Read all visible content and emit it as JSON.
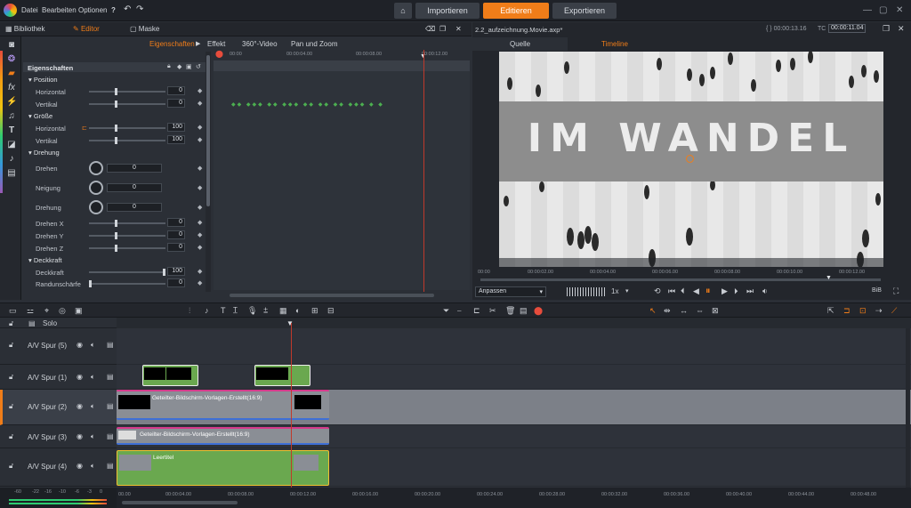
{
  "menu": {
    "items": [
      "Datei",
      "Bearbeiten",
      "Optionen"
    ]
  },
  "nav": {
    "home_icon": "home-icon",
    "import": "Importieren",
    "edit": "Editieren",
    "export": "Exportieren"
  },
  "left_tabs": {
    "library": "Bibliothek",
    "editor": "Editor",
    "mask": "Maske"
  },
  "sub_tabs": {
    "properties": "Eigenschaften",
    "effect": "Effekt",
    "video360": "360°-Video",
    "panzoom": "Pan und Zoom"
  },
  "props": {
    "header": "Eigenschaften",
    "position": "Position",
    "horizontal": "Horizontal",
    "vertical": "Vertikal",
    "size": "Größe",
    "rotation": "Drehung",
    "rotate": "Drehen",
    "tilt": "Neigung",
    "rotation_lbl": "Drehung",
    "rotate_x": "Drehen X",
    "rotate_y": "Drehen Y",
    "rotate_z": "Drehen Z",
    "opacity_group": "Deckkraft",
    "opacity": "Deckkraft",
    "edge_sharpness": "Randunschärfe",
    "values": {
      "pos_h": "0",
      "pos_v": "0",
      "size_h": "100",
      "size_v": "100",
      "rot": "0",
      "tilt": "0",
      "rotation": "0",
      "rot_x": "0",
      "rot_y": "0",
      "rot_z": "0",
      "opacity": "100",
      "edge": "0"
    }
  },
  "kf_ruler": {
    "t0": "00:00",
    "t1": "00:00:04.00",
    "t2": "00:00:08.00",
    "t3": "00:00:12.00"
  },
  "preview": {
    "file": "2.2_aufzeichnung.Movie.axp*",
    "tc_duration": "00:00:13.16",
    "tc_label": "TC",
    "tc_current": "00:00:11.04",
    "tab_source": "Quelle",
    "tab_timeline": "Timeline",
    "title_text": "IM WANDEL",
    "ruler": [
      "00:00",
      "00:00:02.00",
      "00:00:04.00",
      "00:00:06.00",
      "00:00:08.00",
      "00:00:10.00",
      "00:00:12.00"
    ],
    "fit": "Anpassen",
    "speed": "1x",
    "bib": "BiB"
  },
  "timeline": {
    "solo": "Solo",
    "tracks": [
      {
        "name": "A/V Spur (5)"
      },
      {
        "name": "A/V Spur (1)"
      },
      {
        "name": "A/V Spur (2)"
      },
      {
        "name": "A/V Spur (3)"
      },
      {
        "name": "A/V Spur (4)"
      }
    ],
    "clip_track2": "Geteilter-Bildschirm-Vorlagen-Erstellt(16:9)",
    "clip_track3": "Geteilter-Bildschirm-Vorlagen-Erstellt(16:9)",
    "clip_track4": "Leertitel",
    "ruler": [
      "00.00",
      "00:00:04.00",
      "00:00:08.00",
      "00:00:12.00",
      "00:00:16.00",
      "00:00:20.00",
      "00:00:24.00",
      "00:00:28.00",
      "00:00:32.00",
      "00:00:36.00",
      "00:00:40.00",
      "00:00:44.00",
      "00:00:48.00"
    ],
    "meter": [
      "-60",
      "-22",
      "-16",
      "-10",
      "-6",
      "-3",
      "0"
    ]
  },
  "colors": {
    "accent": "#f07d19",
    "clip_green": "#6aa84f",
    "clip_gray": "#8a8e95",
    "playhead": "#c0392b"
  }
}
